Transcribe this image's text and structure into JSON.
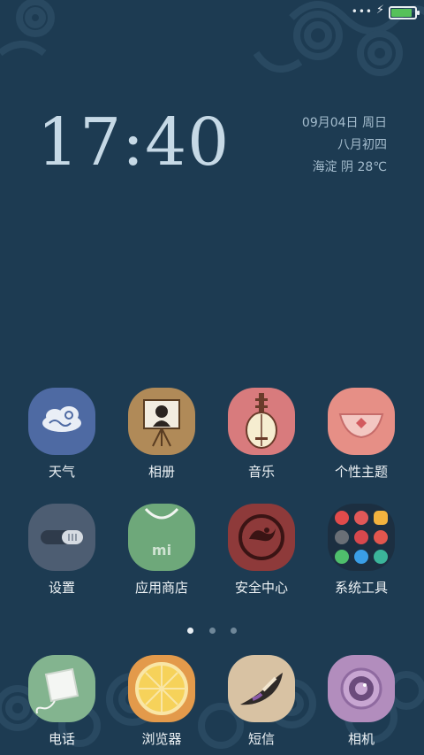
{
  "status_bar": {
    "dots": "•••",
    "battery_color": "#56c15a",
    "battery_level": 0.95
  },
  "clock": {
    "time": "17:40"
  },
  "date": {
    "line1": "09月04日 周日",
    "line2": "八月初四",
    "line3": "海淀 阴 28℃"
  },
  "apps_row1": [
    {
      "label": "天气",
      "icon": "cloud-icon",
      "color": "#4e6aa3"
    },
    {
      "label": "相册",
      "icon": "photo-easel-icon",
      "color": "#b08a58"
    },
    {
      "label": "音乐",
      "icon": "pipa-instrument-icon",
      "color": "#d87b7d"
    },
    {
      "label": "个性主题",
      "icon": "theme-icon",
      "color": "#e68f86"
    }
  ],
  "apps_row2": [
    {
      "label": "设置",
      "icon": "toggle-switch-icon",
      "color": "#4d5d72"
    },
    {
      "label": "应用商店",
      "icon": "shopping-bag-icon",
      "color": "#6ea87a"
    },
    {
      "label": "安全中心",
      "icon": "dragon-seal-icon",
      "color": "#8e3a3a"
    },
    {
      "label": "系统工具",
      "icon": "tools-folder-icon",
      "color": "#1c2f41"
    }
  ],
  "dock": [
    {
      "label": "电话",
      "icon": "phone-cup-icon",
      "color": "#83b48f"
    },
    {
      "label": "浏览器",
      "icon": "orange-slice-icon",
      "color": "#e39a4b"
    },
    {
      "label": "短信",
      "icon": "horn-icon",
      "color": "#d8c2a3"
    },
    {
      "label": "相机",
      "icon": "camera-lens-icon",
      "color": "#b28dbd"
    }
  ],
  "pages": {
    "count": 3,
    "active": 0
  }
}
